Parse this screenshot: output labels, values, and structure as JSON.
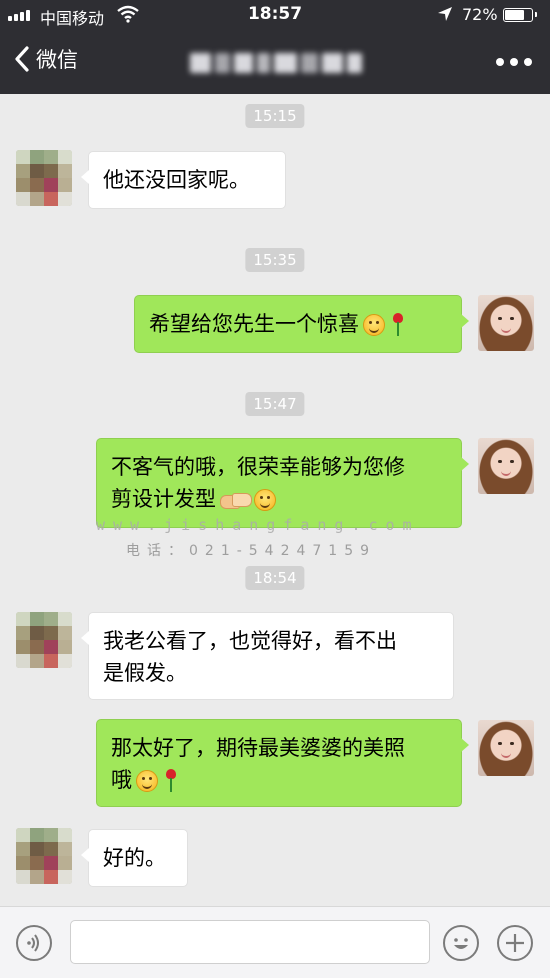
{
  "status_bar": {
    "carrier": "中国移动",
    "time": "18:57",
    "battery_percent": "72%",
    "battery_level": 0.72
  },
  "nav": {
    "back_label": "微信",
    "more_icon": "more-dots-icon"
  },
  "messages": [
    {
      "type": "time",
      "text": "15:15"
    },
    {
      "type": "incoming",
      "text": "他还没回家呢。"
    },
    {
      "type": "time",
      "text": "15:35"
    },
    {
      "type": "outgoing",
      "text": "希望给您先生一个惊喜",
      "emojis": [
        "smile-emoji",
        "rose-emoji"
      ]
    },
    {
      "type": "time",
      "text": "15:47"
    },
    {
      "type": "outgoing",
      "line1": "不客气的哦，很荣幸能够为您修",
      "line2": "剪设计发型",
      "emojis": [
        "handshake-emoji",
        "smile-emoji"
      ]
    },
    {
      "type": "time",
      "text": "18:54"
    },
    {
      "type": "incoming",
      "line1": "我老公看了，也觉得好，看不出",
      "line2": "是假发。"
    },
    {
      "type": "outgoing",
      "line1": "那太好了，期待最美婆婆的美照",
      "line2": "哦",
      "emojis": [
        "smile-emoji",
        "rose-emoji"
      ]
    },
    {
      "type": "incoming",
      "text": "好的。"
    }
  ],
  "watermark": {
    "site": "www.jishangfang.com",
    "phone": "电话：021-54247159"
  },
  "input_bar": {
    "placeholder": "",
    "voice_icon": "voice-icon",
    "emoji_icon": "emoji-face-icon",
    "plus_icon": "plus-icon"
  },
  "colors": {
    "nav_bg": "#2e2e33",
    "chat_bg": "#ebebeb",
    "outgoing_bubble": "#a0e75a",
    "incoming_bubble": "#ffffff",
    "timestamp_bg": "#d1d1d1"
  }
}
